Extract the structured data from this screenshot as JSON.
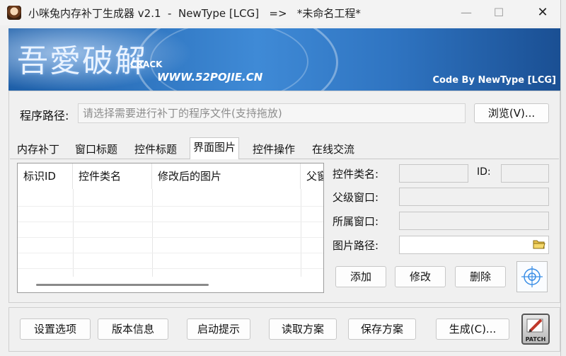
{
  "window": {
    "title": "小咪兔内存补丁生成器 v2.1  -  NewType [LCG]   =>   *未命名工程*",
    "controls": {
      "minimize": "—",
      "maximize": "☐",
      "close": "✕"
    }
  },
  "banner": {
    "logo_text": "吾愛破解",
    "logo_crack": "CRACK",
    "url": "WWW.52POJIE.CN",
    "credit": "Code By NewType [LCG]"
  },
  "program_path": {
    "label": "程序路径:",
    "placeholder": "请选择需要进行补丁的程序文件(支持拖放)",
    "browse_label": "浏览(V)..."
  },
  "tabs": [
    {
      "label": "内存补丁",
      "active": false
    },
    {
      "label": "窗口标题",
      "active": false
    },
    {
      "label": "控件标题",
      "active": false
    },
    {
      "label": "界面图片",
      "active": true
    },
    {
      "label": "控件操作",
      "active": false
    },
    {
      "label": "在线交流",
      "active": false
    }
  ],
  "list": {
    "columns": [
      "标识ID",
      "控件类名",
      "修改后的图片",
      "父窗"
    ]
  },
  "fields": {
    "class_name_label": "控件类名:",
    "id_label": "ID:",
    "parent_window_label": "父级窗口:",
    "owner_window_label": "所属窗口:",
    "image_path_label": "图片路径:"
  },
  "actions": {
    "add": "添加",
    "modify": "修改",
    "delete": "删除"
  },
  "footer": {
    "settings": "设置选项",
    "version": "版本信息",
    "startup_tip": "启动提示",
    "load_scheme": "读取方案",
    "save_scheme": "保存方案",
    "generate": "生成(C)...",
    "patch": "PATCH"
  },
  "icons": {
    "app": "rabbit-avatar-icon",
    "folder": "open-folder-icon",
    "crosshair": "crosshair-target-icon",
    "patch": "patch-pencil-icon"
  }
}
